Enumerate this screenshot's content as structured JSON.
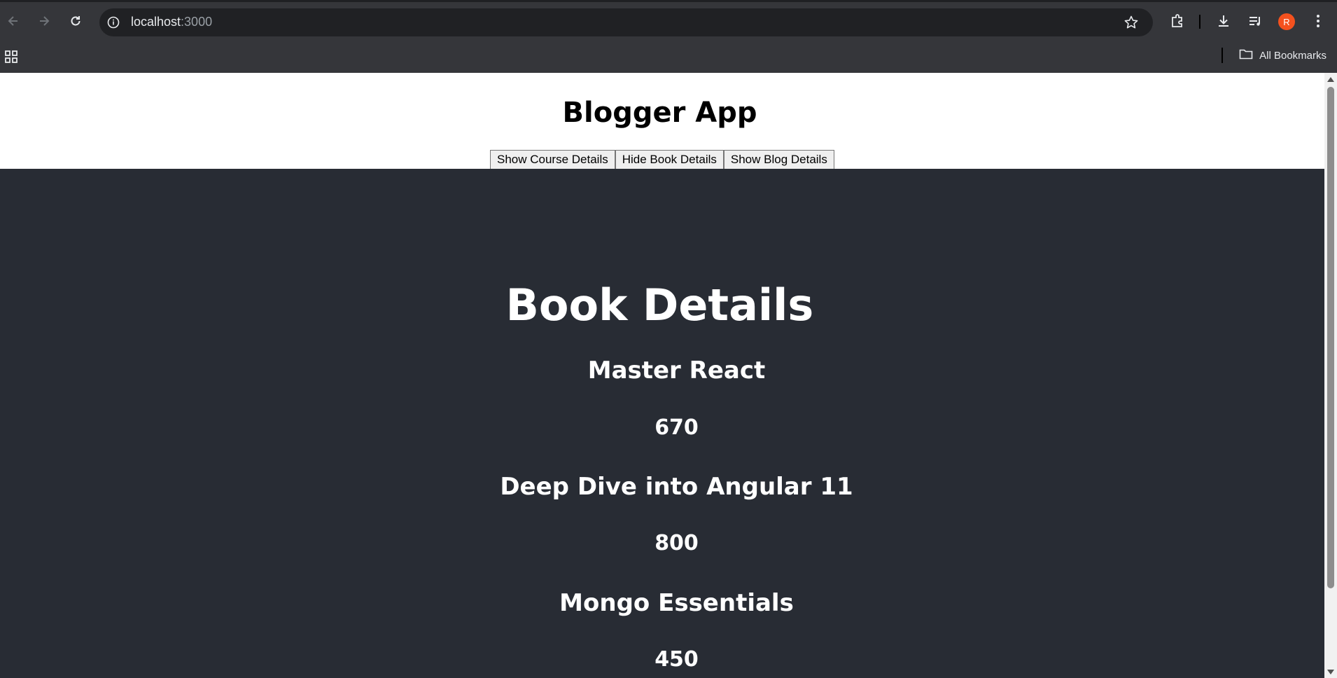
{
  "browser": {
    "url_host": "localhost",
    "url_port": ":3000",
    "bookmarks_label": "All Bookmarks",
    "avatar_letter": "R"
  },
  "app": {
    "title": "Blogger App",
    "buttons": {
      "course": "Show Course Details",
      "book": "Hide Book Details",
      "blog": "Show Blog Details"
    }
  },
  "books": {
    "heading": "Book Details",
    "items": [
      {
        "name": "Master React",
        "price": "670"
      },
      {
        "name": "Deep Dive into Angular 11",
        "price": "800"
      },
      {
        "name": "Mongo Essentials",
        "price": "450"
      }
    ]
  }
}
